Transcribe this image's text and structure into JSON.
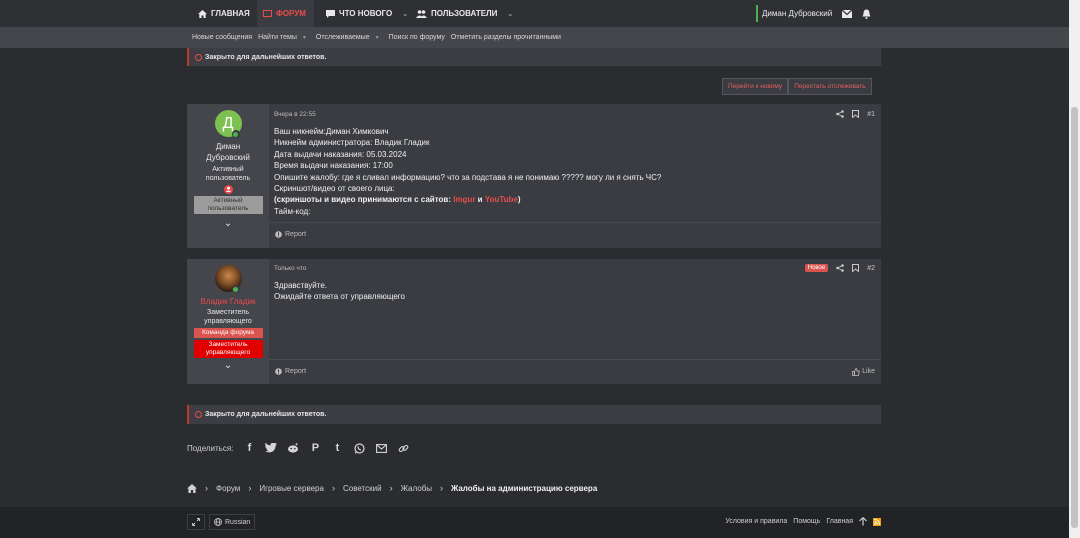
{
  "topnav": {
    "home": "ГЛАВНАЯ",
    "forum": "ФОРУМ",
    "whats_new": "ЧТО НОВОГО",
    "users": "ПОЛЬЗОВАТЕЛИ",
    "username": "Диман Дубровский"
  },
  "subnav": {
    "items": [
      "Новые сообщения",
      "Найти темы",
      "Отслеживаемые",
      "Поиск по форуму",
      "Отметить разделы прочитанными"
    ]
  },
  "notice": {
    "closed": "Закрыто для дальнейших ответов."
  },
  "buttons": {
    "go_new": "Перейти к новому",
    "unwatch": "Перестать отслеживать"
  },
  "post1": {
    "avatar_letter": "Д",
    "user_name": "Диман Дубровский",
    "user_title": "Активный пользователь",
    "badge": "Активный пользователь",
    "date": "Вчера в 22:55",
    "number": "#1",
    "lines": [
      "Ваш никнейм:Диман Химкович",
      "Никнейм администратора: Владик Гладик",
      "Дата выдачи наказания: 05.03.2024",
      "Время выдачи наказания: 17:00",
      "Опишите жалобу: где я сливал информацию? что за подстава я не понимаю ????? могу ли я снять ЧС?",
      "Скриншот/видео от своего лица:"
    ],
    "rule_prefix": "(скриншоты и видео принимаются с сайтов: ",
    "rule_link1": "Imgur",
    "rule_and": " и ",
    "rule_link2": "YouTube",
    "rule_suffix": ")",
    "last_line": "Тайм-код:",
    "report": "Report"
  },
  "post2": {
    "user_name": "Владик Гладик",
    "user_title": "Заместитель управляющего",
    "badge1": "Команда форума",
    "badge2": "Заместитель управляющего",
    "date": "Только что",
    "new_label": "Новое",
    "number": "#2",
    "lines": [
      "Здравствуйте.",
      "Ожидайте ответа от управляющего"
    ],
    "report": "Report",
    "like": "Like"
  },
  "share": {
    "label": "Поделиться:"
  },
  "breadcrumb": {
    "items": [
      "Форум",
      "Игровые сервера",
      "Советский",
      "Жалобы"
    ],
    "current": "Жалобы на администрацию сервера"
  },
  "footer": {
    "language": "Russian",
    "links": [
      "Условия и правила",
      "Помощь",
      "Главная"
    ]
  },
  "colors": {
    "accent": "#e84b4b",
    "online": "#4caf50",
    "background": "#2b2c30"
  }
}
